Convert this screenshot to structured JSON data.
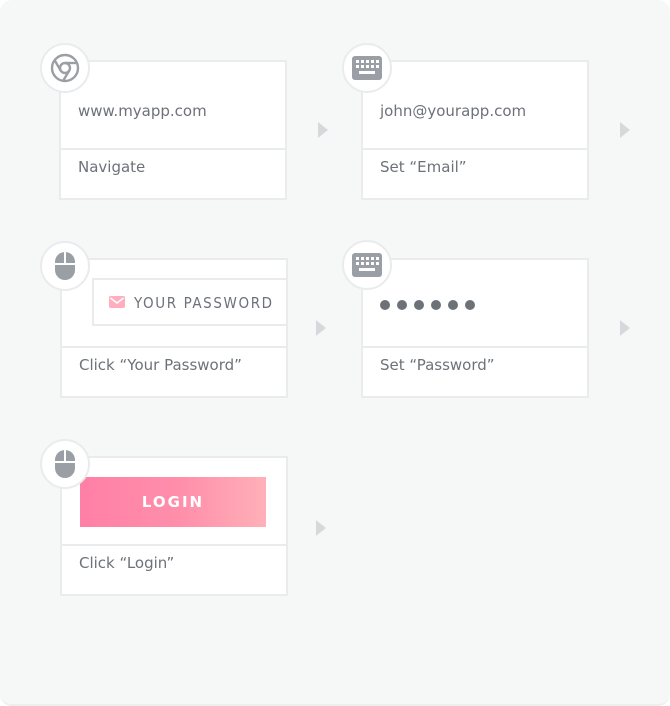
{
  "steps": [
    {
      "preview": "www.myapp.com",
      "caption": "Navigate",
      "icon": "chrome-icon"
    },
    {
      "preview": "john@yourapp.com",
      "caption": "Set “Email”",
      "icon": "keyboard-icon"
    },
    {
      "preview": "YOUR PASSWORD",
      "caption": "Click “Your Password”",
      "icon": "mouse-icon"
    },
    {
      "preview": "••••••",
      "caption": "Set “Password”",
      "icon": "keyboard-icon"
    },
    {
      "preview": "LOGIN",
      "caption": "Click “Login”",
      "icon": "mouse-icon"
    }
  ],
  "colors": {
    "login_gradient_start": "#ff7fa6",
    "login_gradient_end": "#ffb0b8",
    "icon_gray": "#9a9ea5",
    "text_gray": "#6d7279"
  }
}
